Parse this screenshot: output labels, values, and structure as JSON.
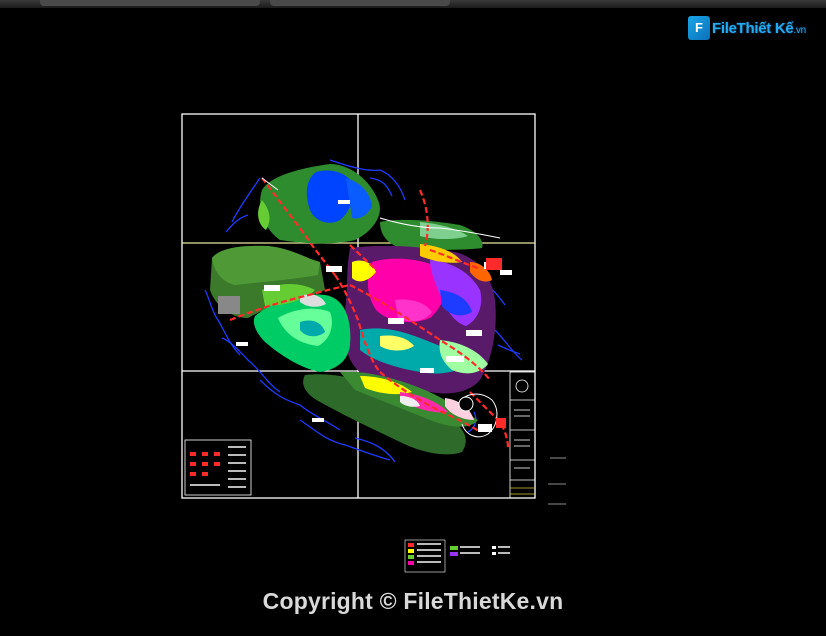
{
  "watermark": {
    "logo_text": "FileThiết Kế",
    "logo_suffix": ".vn",
    "copyright": "Copyright © FileThietKe.vn"
  },
  "map": {
    "type": "urban land-use master plan (CAD drawing)",
    "background": "#000000",
    "sheet_frame_color": "#ffffff",
    "river_color": "#1e3cff",
    "road_color": "#ff2a2a",
    "zone_colors": [
      "#2e8b2e",
      "#66cc33",
      "#0044ff",
      "#ff00aa",
      "#ffff00",
      "#00aaaa",
      "#a0ffa0",
      "#d22",
      "#9933ff"
    ],
    "legend_present": true,
    "title_block_present": true
  }
}
